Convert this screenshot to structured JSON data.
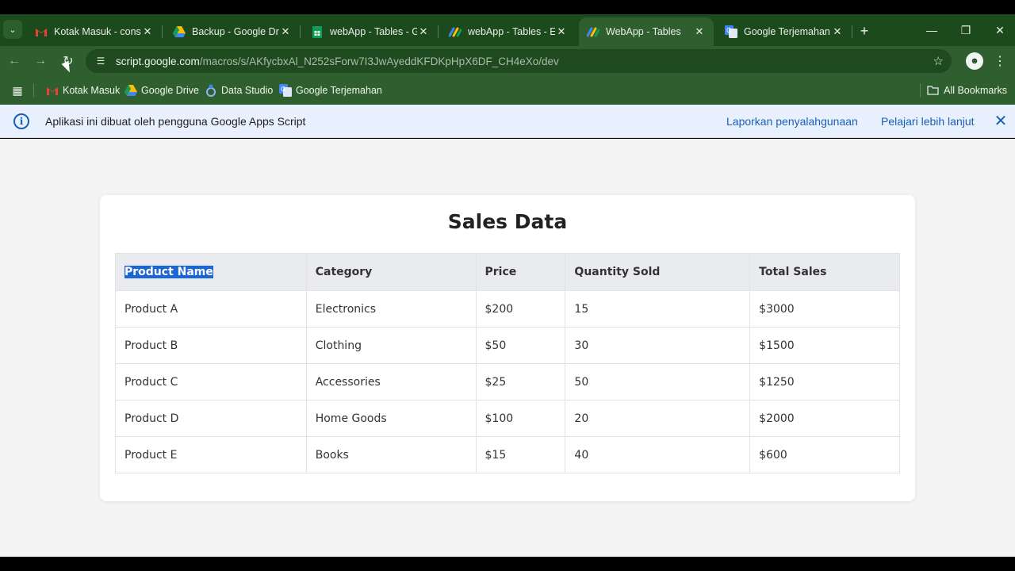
{
  "browser": {
    "tabs": [
      {
        "title": "Kotak Masuk - consul",
        "icon": "gmail-icon",
        "active": false
      },
      {
        "title": "Backup - Google Driv",
        "icon": "google-drive-icon",
        "active": false
      },
      {
        "title": "webApp - Tables - Go",
        "icon": "google-sheets-icon",
        "active": false
      },
      {
        "title": "webApp - Tables - Ed",
        "icon": "apps-script-icon",
        "active": false
      },
      {
        "title": "WebApp - Tables",
        "icon": "apps-script-icon",
        "active": true
      },
      {
        "title": "Google Terjemahan",
        "icon": "google-translate-icon",
        "active": false
      }
    ],
    "url_host": "script.google.com",
    "url_path": "/macros/s/AKfycbxAl_N252sForw7I3JwAyeddKFDKpHpX6DF_CH4eXo/dev",
    "bookmarks": [
      {
        "label": "Kotak Masuk",
        "icon": "gmail-icon"
      },
      {
        "label": "Google Drive",
        "icon": "google-drive-icon"
      },
      {
        "label": "Data Studio",
        "icon": "data-studio-icon"
      },
      {
        "label": "Google Terjemahan",
        "icon": "google-translate-icon"
      }
    ],
    "all_bookmarks": "All Bookmarks"
  },
  "banner": {
    "message": "Aplikasi ini dibuat oleh pengguna Google Apps Script",
    "report_link": "Laporkan penyalahgunaan",
    "learn_link": "Pelajari lebih lanjut"
  },
  "page": {
    "title": "Sales Data",
    "headers": [
      "Product Name",
      "Category",
      "Price",
      "Quantity Sold",
      "Total Sales"
    ],
    "rows": [
      [
        "Product A",
        "Electronics",
        "$200",
        "15",
        "$3000"
      ],
      [
        "Product B",
        "Clothing",
        "$50",
        "30",
        "$1500"
      ],
      [
        "Product C",
        "Accessories",
        "$25",
        "50",
        "$1250"
      ],
      [
        "Product D",
        "Home Goods",
        "$100",
        "20",
        "$2000"
      ],
      [
        "Product E",
        "Books",
        "$15",
        "40",
        "$600"
      ]
    ]
  },
  "colors": {
    "browser_frame": "#1d4a1d",
    "toolbar": "#2f5f2f",
    "banner_bg": "#e8f0fe",
    "link": "#1a5fb4",
    "selection": "#1a66d6"
  }
}
